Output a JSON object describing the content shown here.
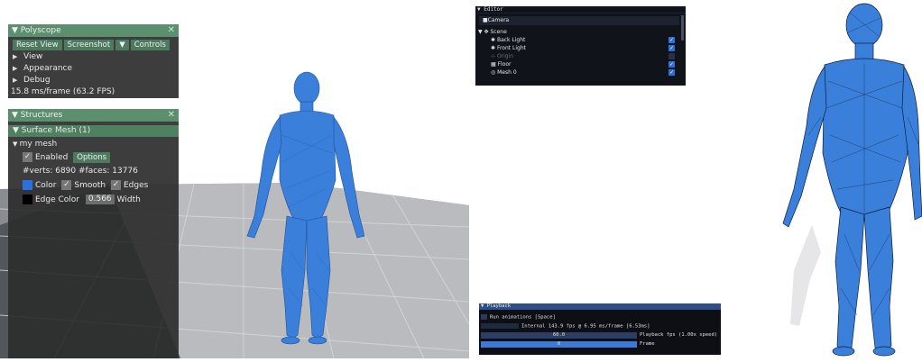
{
  "polyscope": {
    "title": "Polyscope",
    "buttons": [
      "Reset View",
      "Screenshot",
      "Controls"
    ],
    "items": [
      "View",
      "Appearance",
      "Debug"
    ],
    "stats": "15.8 ms/frame (63.2 FPS)"
  },
  "structures": {
    "title": "Structures",
    "group": "Surface Mesh (1)",
    "mesh_name": "my mesh",
    "enabled_label": "Enabled",
    "options_label": "Options",
    "counts": "#verts: 6890  #faces: 13776",
    "color_label": "Color",
    "smooth_label": "Smooth",
    "edges_label": "Edges",
    "edge_color_label": "Edge Color",
    "width_value": "0.566",
    "width_label": "Width",
    "mesh_color": "#2b6fe0",
    "edge_color": "#000000"
  },
  "editor": {
    "title": "Editor",
    "camera_label": "Camera",
    "scene_label": "Scene",
    "items": [
      {
        "label": "Back Light",
        "checked": true
      },
      {
        "label": "Front Light",
        "checked": true
      },
      {
        "label": "Origin",
        "checked": false
      },
      {
        "label": "Floor",
        "checked": true
      },
      {
        "label": "Mesh 0",
        "checked": true
      }
    ]
  },
  "playback": {
    "title": "Playback",
    "run_label": "Run animations [Space]",
    "internal": "Internal 143.9 fps @ 6.95 ms/frame [6.53ms]",
    "fps_value": "60.0",
    "fps_label": "Playback fps (1.00x speed)",
    "frame_value": "0",
    "frame_label": "Frame"
  },
  "colors": {
    "mesh_blue": "#3a7fd9",
    "panel_green": "#5c8f6d",
    "editor_bg": "#10131a",
    "check_blue": "#2f6fd8"
  }
}
